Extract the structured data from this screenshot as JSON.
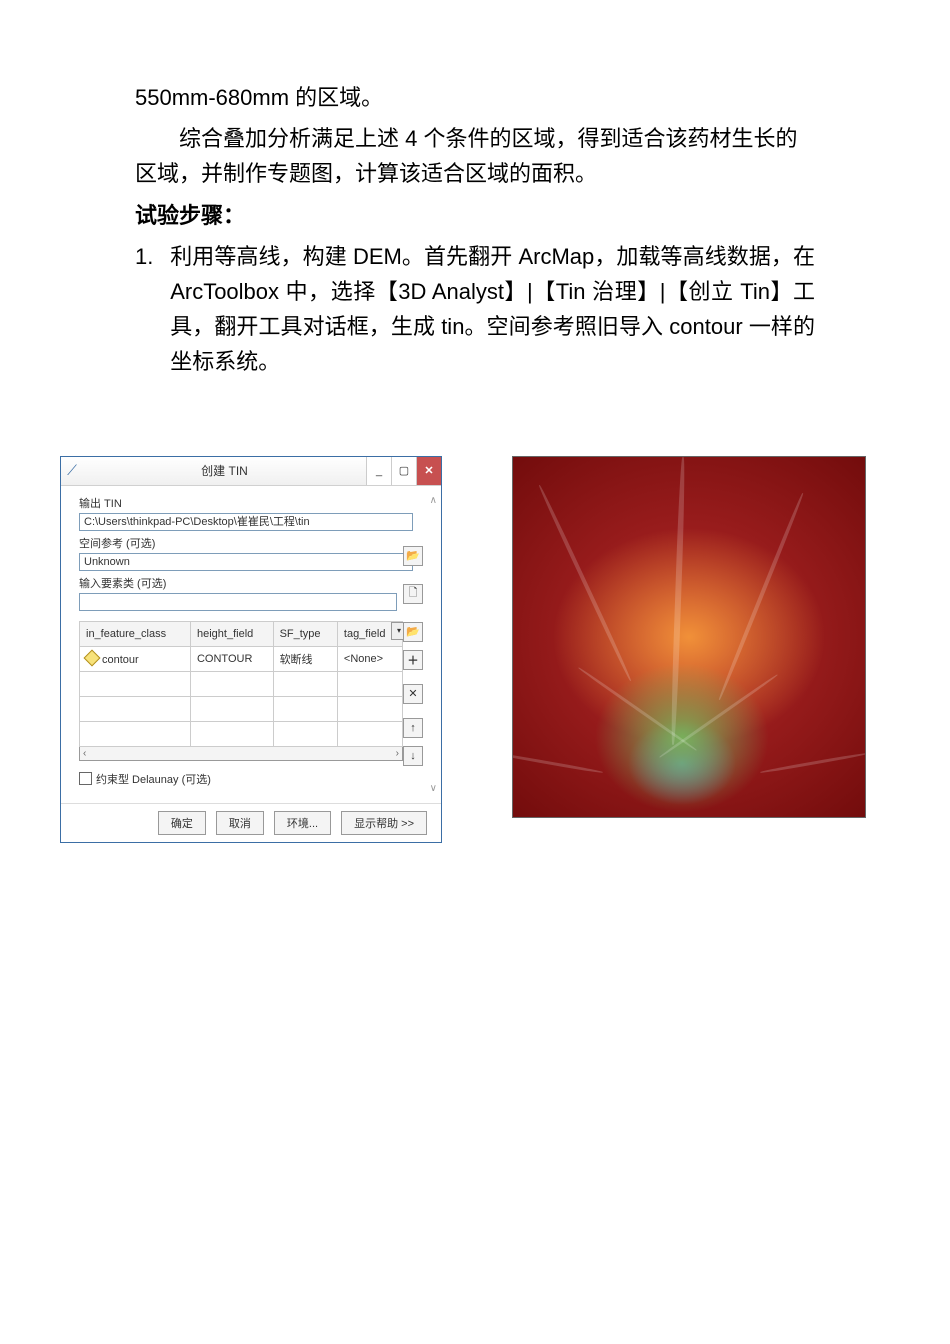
{
  "doc": {
    "prev_fragment": "550mm-680mm 的区域。",
    "paragraph": "综合叠加分析满足上述 4 个条件的区域，得到适合该药材生长的区域，并制作专题图，计算该适合区域的面积。",
    "steps_heading": "试验步骤：",
    "step1_num": "1.",
    "step1_text": "利用等高线，构建 DEM。首先翻开 ArcMap，加载等高线数据，在 ArcToolbox 中，选择【3D  Analyst】|【Tin 治理】|【创立 Tin】工具，翻开工具对话框，生成 tin。空间参考照旧导入 contour 一样的坐标系统。"
  },
  "dialog": {
    "title": "创建 TIN",
    "out_label": "输出 TIN",
    "out_value": "C:\\Users\\thinkpad-PC\\Desktop\\崔崔民\\工程\\tin",
    "sr_label": "空间参考 (可选)",
    "sr_value": "Unknown",
    "in_label": "输入要素类 (可选)",
    "in_value": "",
    "cols": {
      "feat": "in_feature_class",
      "height": "height_field",
      "sf": "SF_type",
      "tag": "tag_field"
    },
    "row": {
      "feat": "contour",
      "height": "CONTOUR",
      "sf": "软断线",
      "tag": "<None>"
    },
    "delaunay": "约束型 Delaunay (可选)",
    "btn_ok": "确定",
    "btn_cancel": "取消",
    "btn_env": "环境...",
    "btn_help": "显示帮助 >>",
    "add_mark": "＋",
    "del_mark": "✕",
    "up_mark": "↑",
    "down_mark": "↓"
  }
}
